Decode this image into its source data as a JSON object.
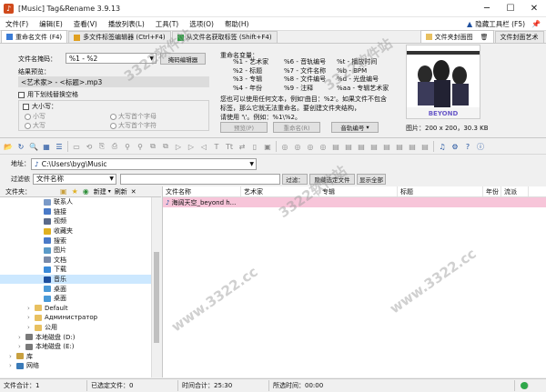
{
  "window": {
    "title": "[Music] Tag&Rename 3.9.13",
    "minimize": "─",
    "maximize": "☐",
    "close": "✕"
  },
  "menu": {
    "items": [
      "文件(F)",
      "编辑(E)",
      "查看(V)",
      "播放列表(L)",
      "工具(T)",
      "选项(O)",
      "帮助(H)"
    ],
    "hide_toolbar": "隐藏工具栏 (F5)"
  },
  "tabs": {
    "rename": "重命名文件 (F4)",
    "multi_editor": "多文件标签编辑器 (Ctrl+F4)",
    "from_filename": "从文件名获取标签 (Shift+F4)",
    "folder_cover": "文件夹封面图",
    "folder_art": "文件封面艺术"
  },
  "rename_panel": {
    "template_label": "文件名掩码：",
    "template_value": "%1 - %2",
    "mask_editor_button": "掩码编辑器",
    "preview_label": "结果预览：",
    "preview_value": "<艺术家> - <标题>.mp3",
    "underscore_checkbox": "用下划线替换空格",
    "case_label": "大小写：",
    "case_options": [
      "小写",
      "大写",
      "大写首个字母",
      "大写首个字符"
    ]
  },
  "variables": {
    "title": "重命名变量：",
    "col1": [
      "%1 - 艺术家",
      "%2 - 标题",
      "%3 - 专辑",
      "%4 - 年份"
    ],
    "col2": [
      "%6 - 音轨编号",
      "%7 - 文件名称",
      "%8 - 文件编号",
      "%9 - 注释"
    ],
    "col3": [
      "%t - 播放时间",
      "%b - BPM",
      "%d - 光盘编号",
      "%aa - 专辑艺术家"
    ],
    "hint_lines": [
      "您也可以使用任何文本，例如'曲目：%2'。如果文件不包含",
      "标签，那么它就无法重命名。要创建文件夹结构，",
      "请使用 '\\'。例如：%1\\%2。"
    ],
    "buttons": {
      "preview": "预览(P)",
      "rename": "重命名(R)",
      "track_number": "音轨编号"
    }
  },
  "cover": {
    "info": "图片：200 x 200，30.3 KB",
    "band_text": "BEYOND"
  },
  "address": {
    "label": "地址：",
    "path": "C:\\Users\\byg\\Music"
  },
  "filter": {
    "label": "过滤依",
    "field": "文件名称",
    "filter_button": "过滤：",
    "hide_button": "隐藏选定文件",
    "show_all": "显示全部"
  },
  "tree_header": {
    "label": "文件夹：",
    "new_button": "新建",
    "refresh_button": "刷新"
  },
  "tree": [
    {
      "label": "联系人",
      "indent": 4,
      "icon": "contacts"
    },
    {
      "label": "链接",
      "indent": 4,
      "icon": "links"
    },
    {
      "label": "视频",
      "indent": 4,
      "icon": "videos"
    },
    {
      "label": "收藏夹",
      "indent": 4,
      "icon": "favorites"
    },
    {
      "label": "搜索",
      "indent": 4,
      "icon": "search"
    },
    {
      "label": "图片",
      "indent": 4,
      "icon": "pictures"
    },
    {
      "label": "文档",
      "indent": 4,
      "icon": "documents"
    },
    {
      "label": "下载",
      "indent": 4,
      "icon": "downloads"
    },
    {
      "label": "音乐",
      "indent": 4,
      "icon": "music",
      "selected": true
    },
    {
      "label": "桌面",
      "indent": 4,
      "icon": "desktop"
    },
    {
      "label": "桌面",
      "indent": 4,
      "icon": "desktop"
    },
    {
      "label": "Default",
      "indent": 3,
      "icon": "folder"
    },
    {
      "label": "Администратор",
      "indent": 3,
      "icon": "folder"
    },
    {
      "label": "公用",
      "indent": 3,
      "icon": "folder"
    },
    {
      "label": "本地磁盘 (D:)",
      "indent": 2,
      "icon": "drive"
    },
    {
      "label": "本地磁盘 (E:)",
      "indent": 2,
      "icon": "drive"
    },
    {
      "label": "库",
      "indent": 1,
      "icon": "library"
    },
    {
      "label": "网络",
      "indent": 1,
      "icon": "network"
    }
  ],
  "columns": [
    "文件名称",
    "艺术家",
    "专辑",
    "标题",
    "年份",
    "流派"
  ],
  "files": [
    {
      "name": "海阔天空_beyond h...",
      "artist": "",
      "album": "",
      "title": "",
      "year": "",
      "genre": ""
    }
  ],
  "status": {
    "file_count": "文件合计：1",
    "selected_count": "已选定文件：0",
    "total_time": "时间合计：25:30",
    "selected_time": "所选时间：00:00"
  },
  "watermark": "www.3322.cc",
  "watermark2": "3322软件站",
  "colors": {
    "accent": "#1d4f9e",
    "selected_row": "#f7c5d9",
    "selected_tree": "#cce8ff"
  }
}
